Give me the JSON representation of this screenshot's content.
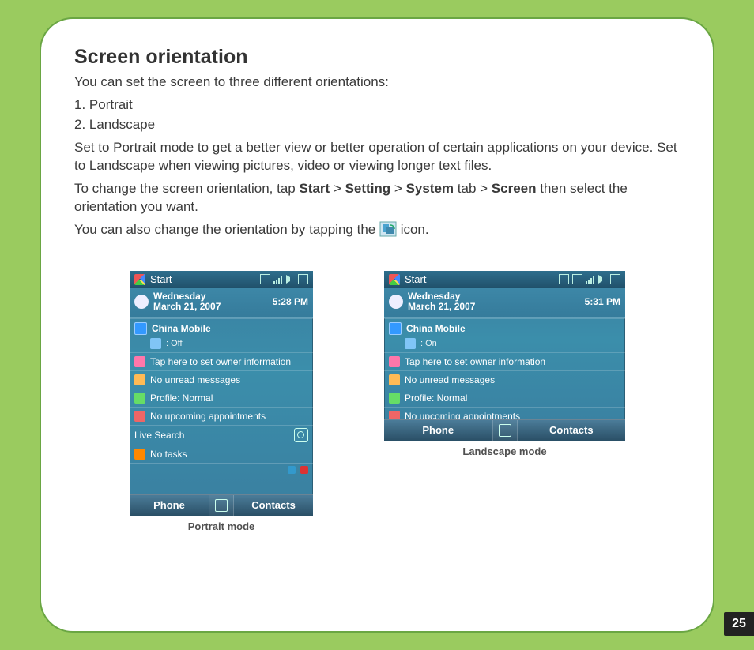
{
  "title": "Screen orientation",
  "intro": "You can set the screen to three different orientations:",
  "list": {
    "i1": "1. Portrait",
    "i2": "2. Landscape"
  },
  "para2": "Set to Portrait mode to get a better view or better operation of certain applications on your device. Set to Landscape when viewing pictures, video or viewing longer text files.",
  "para3_pre": "To change the screen orientation, tap ",
  "nav": {
    "start": "Start",
    "setting": "Setting",
    "system": "System",
    "screen": "Screen"
  },
  "para3_mid_tab": " tab > ",
  "para3_post": " then select the orientation you want.",
  "para4_pre": "You can also change the orientation by tapping the ",
  "para4_post": " icon.",
  "sep": " > ",
  "captions": {
    "portrait": "Portrait mode",
    "landscape": "Landscape mode"
  },
  "pagenum": "25",
  "deviceP": {
    "start": "Start",
    "day": "Wednesday",
    "date": "March 21, 2007",
    "time": "5:28 PM",
    "carrier": "China Mobile",
    "carrier_sub": ": Off",
    "r1": "Tap here to set owner information",
    "r2": "No unread messages",
    "r3": "Profile: Normal",
    "r4": "No upcoming appointments",
    "search": "Live Search",
    "r5": "No tasks",
    "skL": "Phone",
    "skR": "Contacts"
  },
  "deviceL": {
    "start": "Start",
    "day": "Wednesday",
    "date": "March 21, 2007",
    "time": "5:31 PM",
    "carrier": "China Mobile",
    "carrier_sub": ": On",
    "r1": "Tap here to set owner information",
    "r2": "No unread messages",
    "r3": "Profile: Normal",
    "r4": "No upcoming appointments",
    "skL": "Phone",
    "skR": "Contacts"
  }
}
